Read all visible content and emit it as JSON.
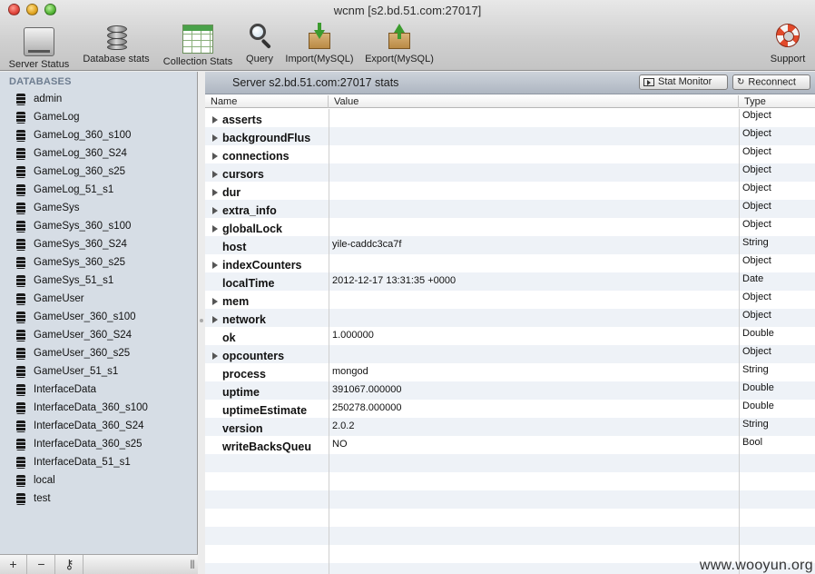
{
  "window": {
    "title": "wcnm [s2.bd.51.com:27017]"
  },
  "toolbar": {
    "server_status": "Server Status",
    "database_stats": "Database stats",
    "collection_stats": "Collection Stats",
    "query": "Query",
    "import_mysql": "Import(MySQL)",
    "export_mysql": "Export(MySQL)",
    "support": "Support"
  },
  "sidebar": {
    "header": "DATABASES",
    "databases": [
      "admin",
      "GameLog",
      "GameLog_360_s100",
      "GameLog_360_S24",
      "GameLog_360_s25",
      "GameLog_51_s1",
      "GameSys",
      "GameSys_360_s100",
      "GameSys_360_S24",
      "GameSys_360_s25",
      "GameSys_51_s1",
      "GameUser",
      "GameUser_360_s100",
      "GameUser_360_S24",
      "GameUser_360_s25",
      "GameUser_51_s1",
      "InterfaceData",
      "InterfaceData_360_s100",
      "InterfaceData_360_S24",
      "InterfaceData_360_s25",
      "InterfaceData_51_s1",
      "local",
      "test"
    ],
    "add_button": "+",
    "remove_button": "−",
    "key_button": "⚷",
    "grip": "|||"
  },
  "main": {
    "title": "Server s2.bd.51.com:27017 stats",
    "stat_monitor_button": "Stat Monitor",
    "reconnect_button": "Reconnect",
    "columns": {
      "name": "Name",
      "value": "Value",
      "type": "Type"
    },
    "rows": [
      {
        "name": "asserts",
        "value": "",
        "type": "Object",
        "expandable": true
      },
      {
        "name": "backgroundFlus",
        "value": "",
        "type": "Object",
        "expandable": true
      },
      {
        "name": "connections",
        "value": "",
        "type": "Object",
        "expandable": true
      },
      {
        "name": "cursors",
        "value": "",
        "type": "Object",
        "expandable": true
      },
      {
        "name": "dur",
        "value": "",
        "type": "Object",
        "expandable": true
      },
      {
        "name": "extra_info",
        "value": "",
        "type": "Object",
        "expandable": true
      },
      {
        "name": "globalLock",
        "value": "",
        "type": "Object",
        "expandable": true
      },
      {
        "name": "host",
        "value": "yile-caddc3ca7f",
        "type": "String",
        "expandable": false
      },
      {
        "name": "indexCounters",
        "value": "",
        "type": "Object",
        "expandable": true
      },
      {
        "name": "localTime",
        "value": "2012-12-17 13:31:35 +0000",
        "type": "Date",
        "expandable": false
      },
      {
        "name": "mem",
        "value": "",
        "type": "Object",
        "expandable": true
      },
      {
        "name": "network",
        "value": "",
        "type": "Object",
        "expandable": true
      },
      {
        "name": "ok",
        "value": "1.000000",
        "type": "Double",
        "expandable": false
      },
      {
        "name": "opcounters",
        "value": "",
        "type": "Object",
        "expandable": true
      },
      {
        "name": "process",
        "value": "mongod",
        "type": "String",
        "expandable": false
      },
      {
        "name": "uptime",
        "value": "391067.000000",
        "type": "Double",
        "expandable": false
      },
      {
        "name": "uptimeEstimate",
        "value": "250278.000000",
        "type": "Double",
        "expandable": false
      },
      {
        "name": "version",
        "value": "2.0.2",
        "type": "String",
        "expandable": false
      },
      {
        "name": "writeBacksQueu",
        "value": "NO",
        "type": "Bool",
        "expandable": false
      }
    ]
  },
  "watermark": "www.wooyun.org"
}
